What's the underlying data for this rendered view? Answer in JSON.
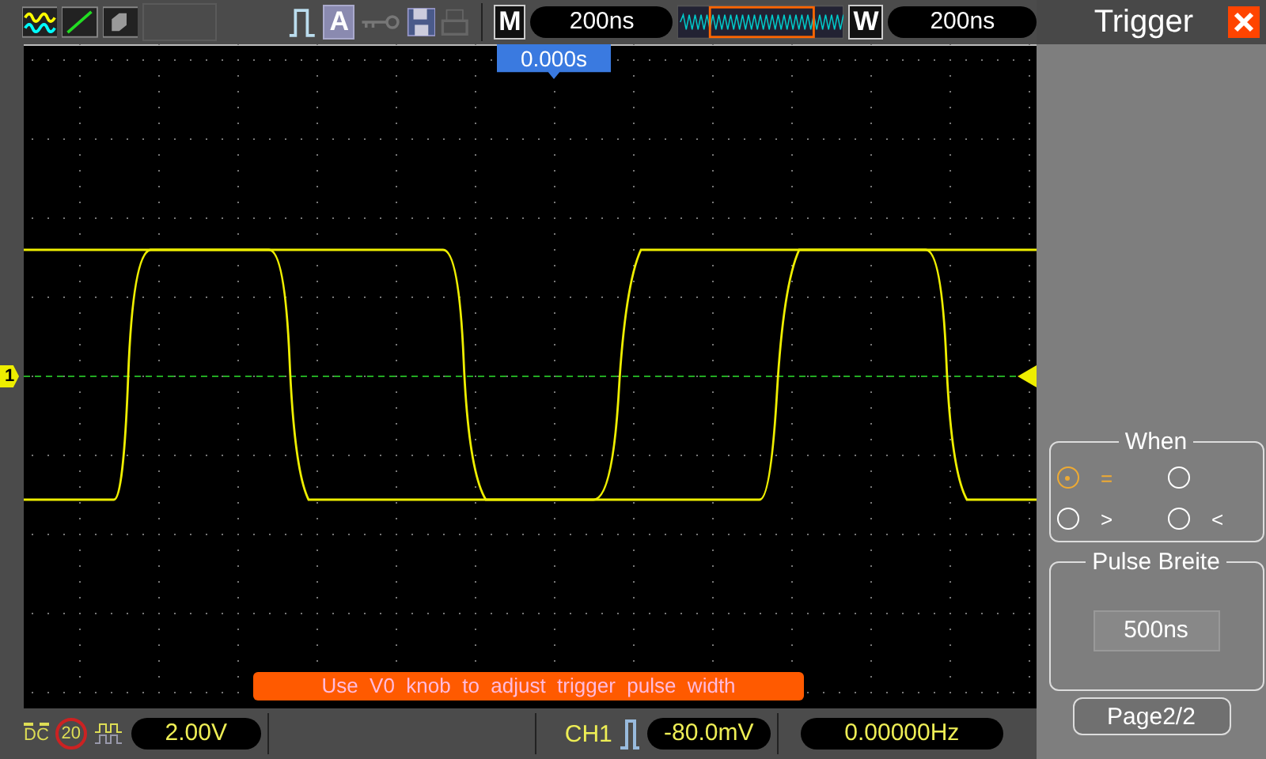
{
  "toolbar": {
    "auto_label": "A",
    "main_label": "M",
    "main_timebase": "200ns",
    "window_label": "W",
    "window_timebase": "200ns"
  },
  "screen": {
    "trigger_time": "0.000s",
    "channel_marker": "1",
    "hint": "Use  V0  knob  to  adjust  trigger  pulse  width"
  },
  "status_bar": {
    "coupling": "DC",
    "bandwidth_limit": "20",
    "volts_per_div": "2.00V",
    "trigger_source": "CH1",
    "trigger_level": "-80.0mV",
    "frequency": "0.00000Hz"
  },
  "panel": {
    "title": "Trigger",
    "when": {
      "title": "When",
      "options": [
        {
          "label": "=",
          "selected": true
        },
        {
          "selected": false
        },
        {
          "label": ">",
          "selected": false
        },
        {
          "label": "<",
          "selected": false
        }
      ]
    },
    "pulse_width": {
      "title": "Pulse  Breite",
      "value": "500ns"
    },
    "page_button": "Page2/2"
  }
}
